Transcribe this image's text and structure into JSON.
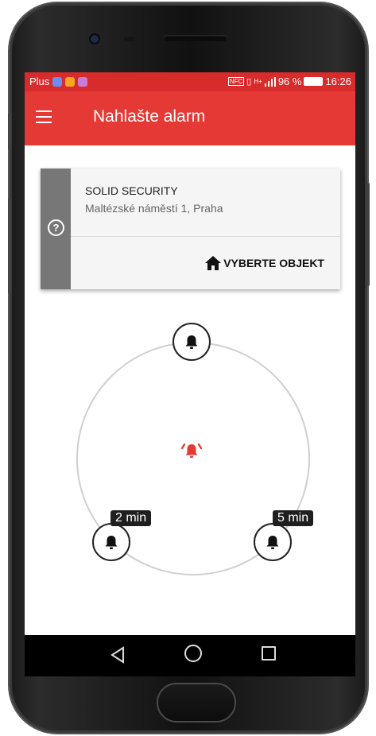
{
  "status_bar": {
    "carrier": "Plus",
    "signal_text": "96 %",
    "time": "16:26",
    "nfc_label": "NFC",
    "network_label": "H+"
  },
  "app_bar": {
    "title": "Nahlašte alarm",
    "menu_icon": "hamburger-menu-icon"
  },
  "object_card": {
    "name": "SOLID SECURITY",
    "address": "Maltézské náměstí 1,  Praha",
    "select_button": "VYBERTE OBJEKT",
    "help_icon": "question-mark-icon",
    "help_glyph": "?",
    "home_icon": "home-icon"
  },
  "alarm_diagram": {
    "center_icon": "alarm-bell-ringing-icon",
    "nodes": [
      {
        "icon": "bell-icon",
        "label": ""
      },
      {
        "icon": "bell-icon",
        "label": "2 min"
      },
      {
        "icon": "bell-icon",
        "label": "5 min"
      }
    ]
  },
  "navigation": {
    "back": "back-triangle-icon",
    "home": "home-circle-icon",
    "recent": "recent-apps-square-icon"
  },
  "colors": {
    "status_bar": "#d82b2b",
    "app_bar": "#e53935",
    "card_strip": "#777777",
    "alarm_red": "#e53935"
  }
}
